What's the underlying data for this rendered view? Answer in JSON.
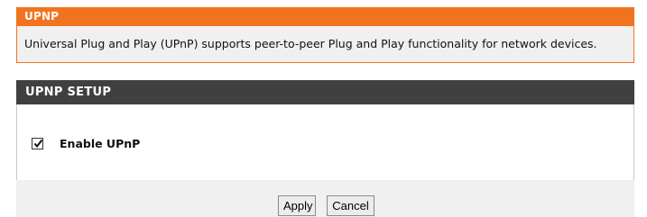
{
  "info": {
    "title": "UPNP",
    "description": "Universal Plug and Play (UPnP) supports peer-to-peer Plug and Play functionality for network devices."
  },
  "setup": {
    "title": "UPNP SETUP",
    "enable_label": "Enable UPnP",
    "enable_checked": true
  },
  "buttons": {
    "apply_label": "Apply",
    "cancel_label": "Cancel"
  },
  "colors": {
    "accent_orange": "#f2731f",
    "section_header_dark": "#404040",
    "panel_gray": "#f0f0f0"
  },
  "icons": {
    "checkbox_mark": "checkmark-icon"
  }
}
